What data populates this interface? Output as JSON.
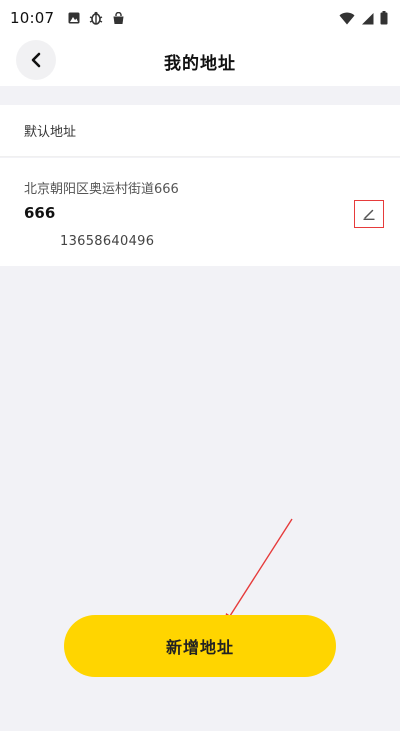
{
  "status_bar": {
    "time": "10:07",
    "left_icons": [
      "gallery-icon",
      "bug-icon",
      "shopping-bag-icon"
    ],
    "right_icons": [
      "wifi-icon",
      "signal-icon",
      "battery-icon"
    ]
  },
  "header": {
    "title": "我的地址",
    "back_icon": "chevron-left-icon"
  },
  "section": {
    "label": "默认地址"
  },
  "address": {
    "line": "北京朝阳区奥运村街道666",
    "name": "666",
    "phone": "13658640496",
    "edit_icon": "pencil-icon"
  },
  "add_button": {
    "label": "新增地址"
  },
  "colors": {
    "accent": "#ffd500",
    "annotation": "#e63b3b",
    "background": "#f2f2f6"
  }
}
